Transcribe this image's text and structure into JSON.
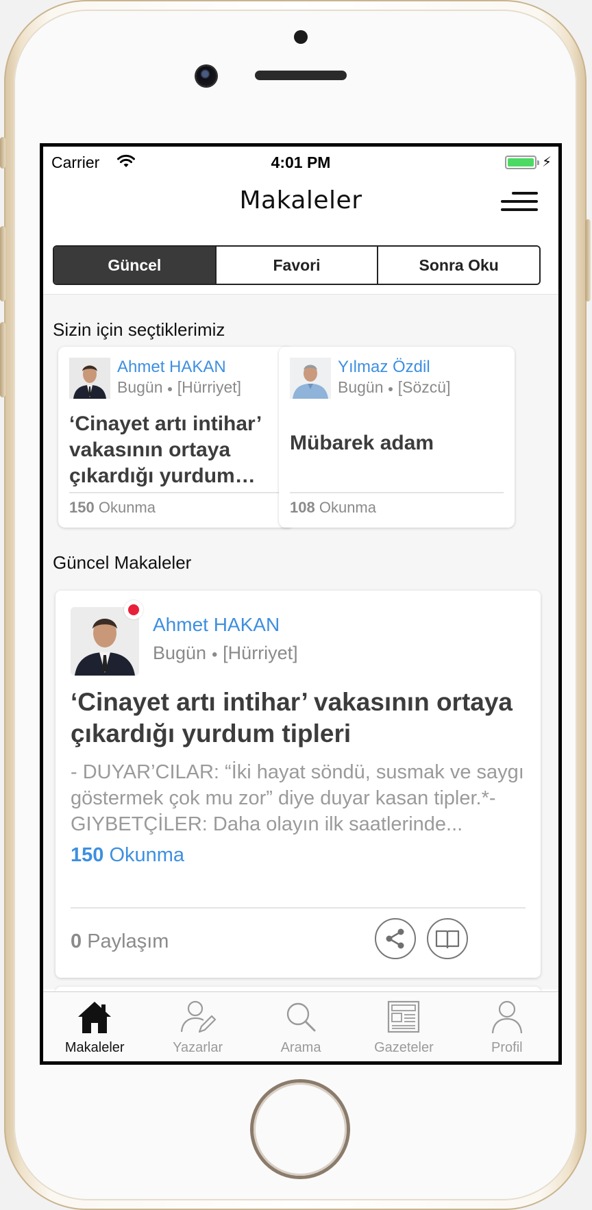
{
  "status_bar": {
    "carrier": "Carrier",
    "time": "4:01 PM"
  },
  "nav": {
    "title": "Makaleler"
  },
  "segments": [
    {
      "label": "Güncel",
      "active": true
    },
    {
      "label": "Favori",
      "active": false
    },
    {
      "label": "Sonra Oku",
      "active": false
    }
  ],
  "picks": {
    "heading": "Sizin için seçtiklerimiz",
    "cards": [
      {
        "author": "Ahmet HAKAN",
        "date": "Bugün",
        "source": "[Hürriyet]",
        "title": "‘Cinayet artı intihar’ vakasının ortaya çıkardığı yurdum tipleri",
        "reads_count": "150",
        "reads_label": "Okunma"
      },
      {
        "author": "Yılmaz Özdil",
        "date": "Bugün",
        "source": "[Sözcü]",
        "title": "Mübarek adam",
        "reads_count": "108",
        "reads_label": "Okunma"
      }
    ]
  },
  "current": {
    "heading": "Güncel Makaleler",
    "article": {
      "author": "Ahmet HAKAN",
      "date": "Bugün",
      "source": "[Hürriyet]",
      "title": "‘Cinayet artı intihar’ vakasının ortaya çıkardığı yurdum tipleri",
      "excerpt": "- DUYAR’CILAR: “İki hayat söndü, susmak ve saygı göstermek çok mu zor” diye duyar kasan tipler.*- GIYBETÇİLER: Daha olayın ilk saatlerinde...",
      "reads_count": "150",
      "reads_label": "Okunma",
      "shares_count": "0",
      "shares_label": "Paylaşım"
    }
  },
  "tabbar": [
    {
      "label": "Makaleler",
      "icon": "home-icon",
      "active": true
    },
    {
      "label": "Yazarlar",
      "icon": "writer-icon",
      "active": false
    },
    {
      "label": "Arama",
      "icon": "search-icon",
      "active": false
    },
    {
      "label": "Gazeteler",
      "icon": "newspaper-icon",
      "active": false
    },
    {
      "label": "Profil",
      "icon": "profile-icon",
      "active": false
    }
  ],
  "colors": {
    "accent": "#3d8fe0",
    "live": "#e8203a",
    "segment_active": "#3a3a3a",
    "battery": "#4cd964"
  }
}
